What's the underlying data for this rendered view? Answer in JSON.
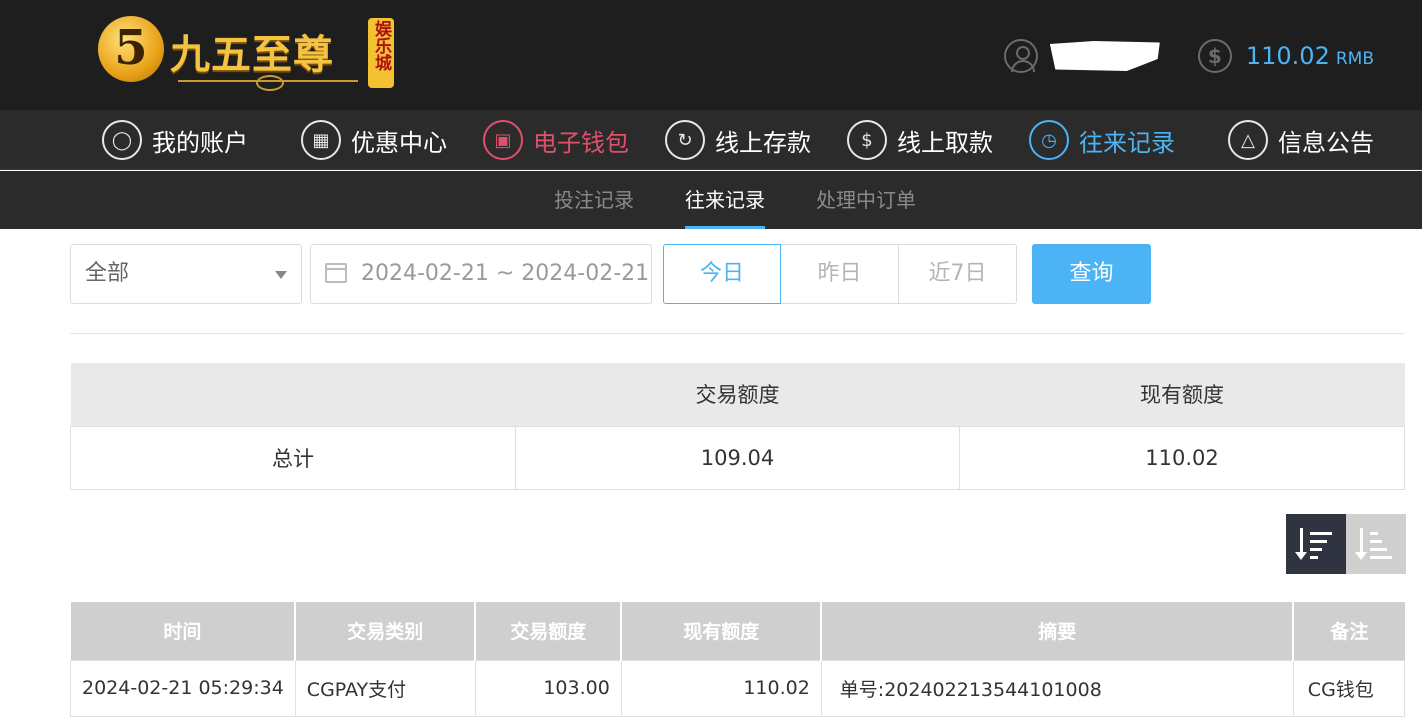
{
  "brand": {
    "badge": "5",
    "name": "九五至尊",
    "tag": "娱乐城"
  },
  "account": {
    "username_masked": "",
    "balance": "110.02",
    "currency": "RMB"
  },
  "main_nav": [
    {
      "label": "我的账户",
      "icon": "user-icon"
    },
    {
      "label": "优惠中心",
      "icon": "gift-icon"
    },
    {
      "label": "电子钱包",
      "icon": "wallet-icon"
    },
    {
      "label": "线上存款",
      "icon": "deposit-icon"
    },
    {
      "label": "线上取款",
      "icon": "withdraw-icon"
    },
    {
      "label": "往来记录",
      "icon": "records-icon",
      "active": true
    },
    {
      "label": "信息公告",
      "icon": "bell-icon"
    }
  ],
  "sub_nav": [
    {
      "label": "投注记录"
    },
    {
      "label": "往来记录",
      "active": true
    },
    {
      "label": "处理中订单"
    }
  ],
  "filters": {
    "type_select": "全部",
    "date_range": "2024-02-21 ~ 2024-02-21",
    "quick_ranges": [
      "今日",
      "昨日",
      "近7日"
    ],
    "active_quick": "今日",
    "query_label": "查询"
  },
  "summary": {
    "headers": [
      "",
      "交易额度",
      "现有额度"
    ],
    "row": [
      "总计",
      "109.04",
      "110.02"
    ]
  },
  "records": {
    "headers": [
      "时间",
      "交易类别",
      "交易额度",
      "现有额度",
      "摘要",
      "备注"
    ],
    "rows": [
      [
        "2024-02-21 05:29:34",
        "CGPAY支付",
        "103.00",
        "110.02",
        "单号:20240221354410100​8",
        "CG钱包"
      ]
    ]
  },
  "colors": {
    "accent": "#4cb3f4",
    "wallet": "#e0506b",
    "header_bg": "#1e1e1e",
    "nav_bg": "#2b2b2b"
  }
}
